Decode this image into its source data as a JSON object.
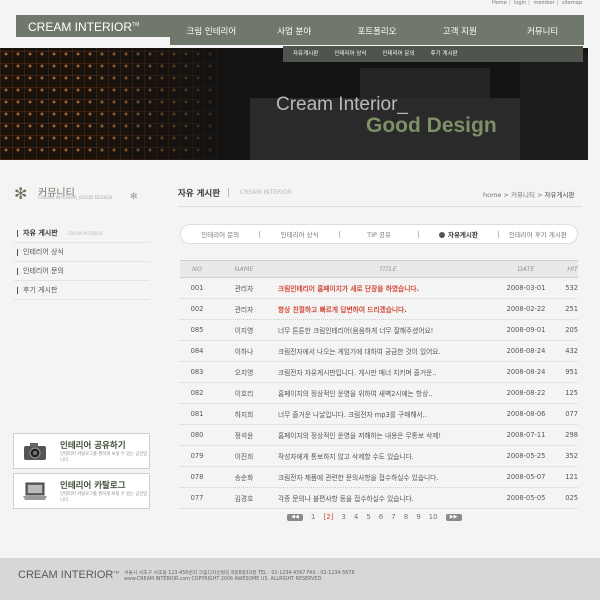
{
  "utility": {
    "home": "Home",
    "login": "login",
    "member": "member",
    "sitemap": "sitemap"
  },
  "logo": {
    "text": "CREAM INTERIOR",
    "mark": "TM"
  },
  "main_nav": [
    "크림 인테리어",
    "사업 분야",
    "포트폴리오",
    "고객 지원",
    "커뮤니티"
  ],
  "sub_nav": [
    "자유게시판",
    "인테리어 상식",
    "인테리어 문의",
    "후기 게시판"
  ],
  "banner": {
    "line1": "Cream Interior_",
    "line2": "Good Design"
  },
  "sidebar": {
    "title": "커뮤니티",
    "subtitle": "CREAM INTERIOR_GOOD DESIGN",
    "items": [
      {
        "label": "자유 게시판",
        "note": "CREAM INTERIOR"
      },
      {
        "label": "인테리어 상식",
        "note": ""
      },
      {
        "label": "인테리어 문의",
        "note": ""
      },
      {
        "label": "후기 게시판",
        "note": ""
      }
    ],
    "promos": [
      {
        "title": "인테리어 공유하기",
        "desc": "인테리어 카탈로그를 편하게 보실 수 있는 공간입니다."
      },
      {
        "title": "인테리어 카탈로그",
        "desc": "인테리어 카탈로그를 편하게 보실 수 있는 공간입니다."
      }
    ]
  },
  "content": {
    "title": "자유 게시판",
    "title_eng": "CREAM INTERIOR",
    "breadcrumb": [
      "home",
      "커뮤니티",
      "자유게시판"
    ]
  },
  "tabs": [
    "인테리어 문의",
    "인테리어 상식",
    "TIP 공유",
    "자유게시판",
    "인테리어 후기 게시판"
  ],
  "table": {
    "headers": {
      "no": "NO",
      "name": "NAME",
      "title": "TITLE",
      "date": "DATE",
      "hit": "HIT"
    },
    "rows": [
      {
        "no": "001",
        "name": "관리자",
        "title": "크림인테리어 홈페이지가 새로 단장을 하였습니다.",
        "date": "2008-03-01",
        "hit": "532"
      },
      {
        "no": "002",
        "name": "관리자",
        "title": "항상 친절하고 빠르게 답변하여 드리겠습니다.",
        "date": "2008-02-22",
        "hit": "251"
      },
      {
        "no": "085",
        "name": "이지영",
        "title": "너무 튼튼한 크림인테리어(음음하게 너무 잘해주셨어요!",
        "date": "2008-09-01",
        "hit": "205"
      },
      {
        "no": "084",
        "name": "이하나",
        "title": "크림전자에서 나오는 게임기에 대하여 궁금한 것이 있어요.",
        "date": "2008-08-24",
        "hit": "432"
      },
      {
        "no": "083",
        "name": "오지영",
        "title": "크림전자 자유게시판입니다. 게시판 매너 지키며 즐거운..",
        "date": "2008-08-24",
        "hit": "951"
      },
      {
        "no": "082",
        "name": "이호리",
        "title": "홈페이지의 정상적인 운영을 위하여 새벽2시에는 항상..",
        "date": "2008-08-22",
        "hit": "125"
      },
      {
        "no": "081",
        "name": "하지희",
        "title": "너무 즐거운 나날입니다. 크림전자 mp3를 구매해서..",
        "date": "2008-08-06",
        "hit": "077"
      },
      {
        "no": "080",
        "name": "정석윤",
        "title": "홈페이지의 정상적인 운영을 저해하는 내용은 무통보 삭제!",
        "date": "2008-07-11",
        "hit": "298"
      },
      {
        "no": "079",
        "name": "이진희",
        "title": "작성자에게 통보하지 않고 삭제할 수도 있습니다.",
        "date": "2008-05-25",
        "hit": "352"
      },
      {
        "no": "078",
        "name": "송순화",
        "title": "크림전자 제품에 관련한 문의사항을 접수하실수 있습니다.",
        "date": "2008-05-07",
        "hit": "121"
      },
      {
        "no": "077",
        "name": "김경호",
        "title": "각종 문의나 불편사항 등을 접수하실수 있습니다.",
        "date": "2008-05-05",
        "hit": "025"
      }
    ]
  },
  "pager": {
    "pages": [
      "1",
      "2",
      "3",
      "4",
      "5",
      "6",
      "7",
      "8",
      "9",
      "10"
    ],
    "current": "2"
  },
  "footer": {
    "logo": "CREAM INTERIOR",
    "address": "서울시 서초구 서초동 123-456번지 크림디자인빌딩 8층8층10층   TEL : 02-1234-4567   FAX : 02-1234-5678",
    "copyright": "www.CREAM INTERIOR.com COPYRIGHT 2006 AWESOME US. ALLRIGHT RESERVED."
  },
  "colors": {
    "nav": "#70786c",
    "accent_green": "#7d9068",
    "highlight_red": "#d24b3a"
  }
}
